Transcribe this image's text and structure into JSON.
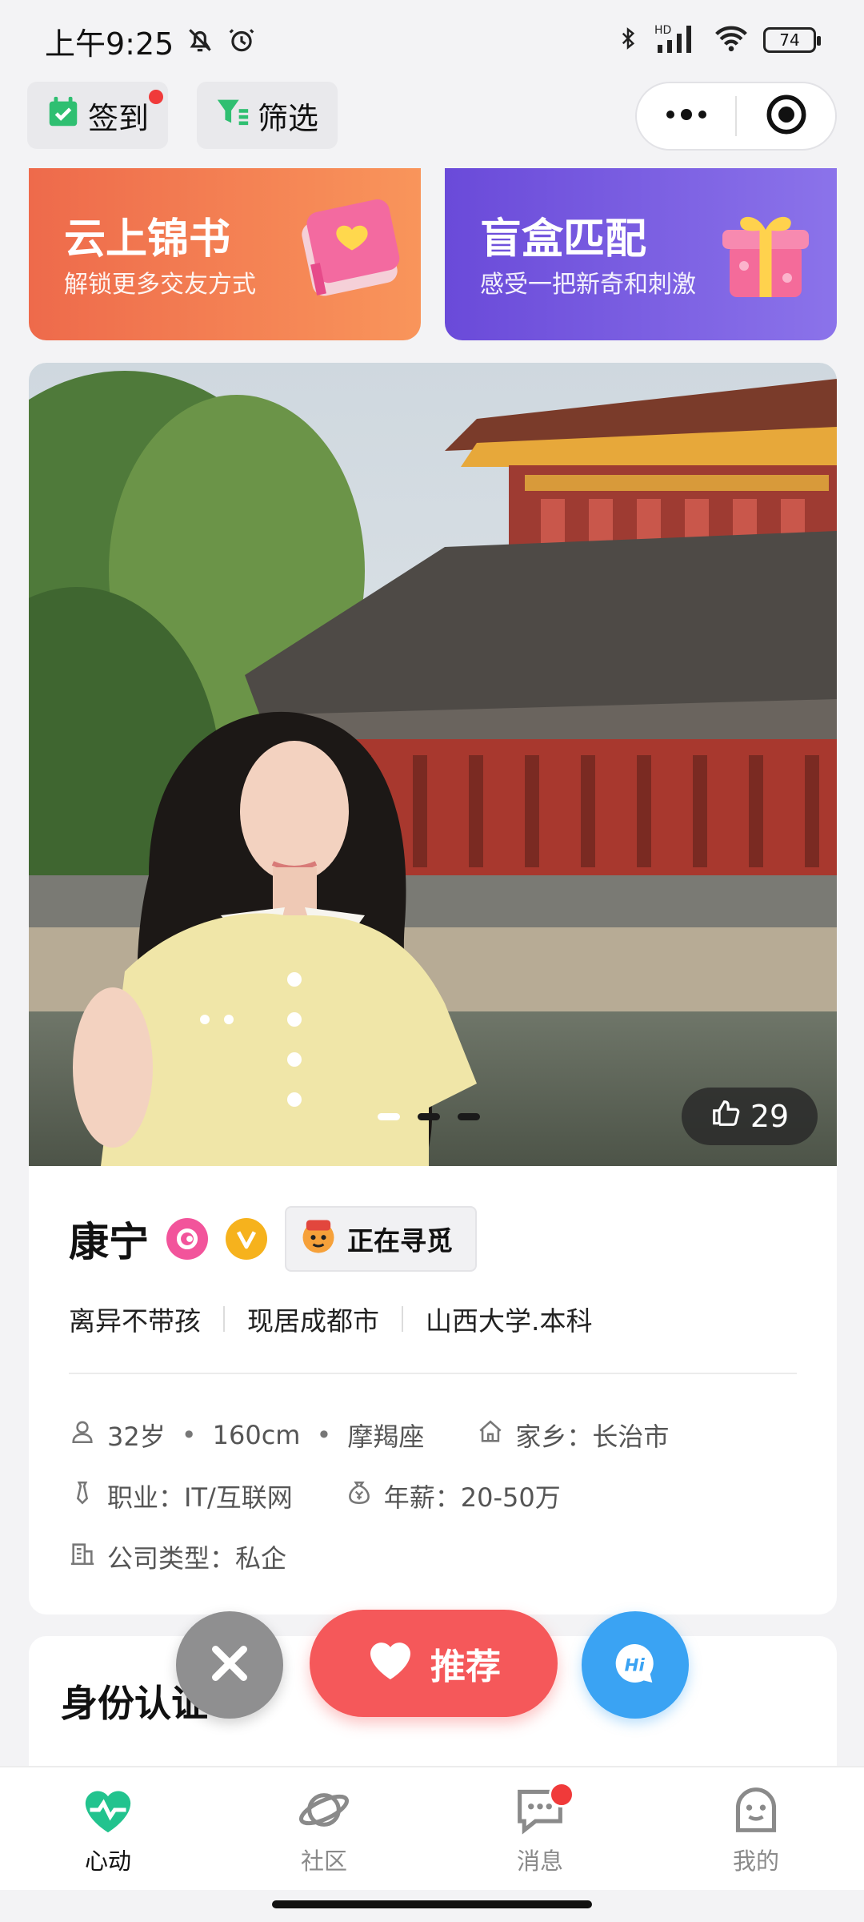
{
  "status_bar": {
    "time": "上午9:25",
    "battery": "74"
  },
  "top_nav": {
    "checkin_label": "签到",
    "filter_label": "筛选"
  },
  "banners": [
    {
      "title": "云上锦书",
      "subtitle": "解锁更多交友方式"
    },
    {
      "title": "盲盒匹配",
      "subtitle": "感受一把新奇和刺激"
    }
  ],
  "profile": {
    "like_count": "29",
    "photo_index": 1,
    "photo_total": 3,
    "name": "康宁",
    "seeking_label": "正在寻觅",
    "tags": [
      "离异不带孩",
      "现居成都市",
      "山西大学.本科"
    ],
    "age": "32岁",
    "height": "160cm",
    "zodiac": "摩羯座",
    "hometown": "家乡：长治市",
    "job": "职业：IT/互联网",
    "salary": "年薪：20-50万",
    "company_type": "公司类型：私企"
  },
  "actions": {
    "recommend_label": "推荐"
  },
  "identity": {
    "title": "身份认证"
  },
  "tab_bar": {
    "items": [
      {
        "label": "心动",
        "active": true
      },
      {
        "label": "社区",
        "active": false
      },
      {
        "label": "消息",
        "active": false
      },
      {
        "label": "我的",
        "active": false
      }
    ]
  },
  "colors": {
    "accent_red": "#f5585a",
    "hi_blue": "#3aa3f3",
    "active_tab_green": "#22c38e"
  }
}
